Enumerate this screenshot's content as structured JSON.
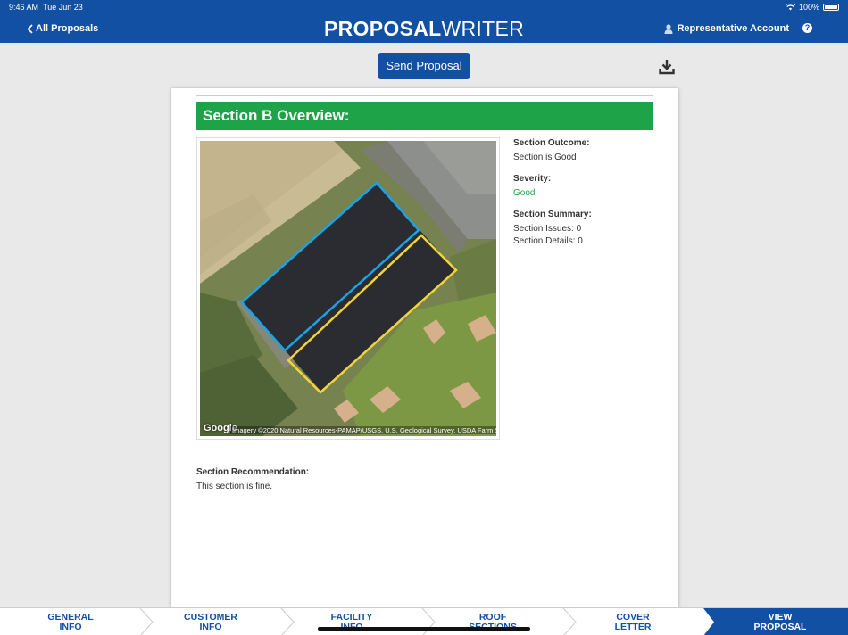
{
  "status": {
    "time": "9:46 AM",
    "date": "Tue Jun 23",
    "battery": "100%"
  },
  "header": {
    "back_label": "All Proposals",
    "brand_bold": "PROPOSAL",
    "brand_light": "WRITER",
    "account_label": "Representative Account",
    "help_glyph": "?"
  },
  "toolbar": {
    "send_label": "Send Proposal",
    "download_icon": "download-icon"
  },
  "section": {
    "title": "Section B Overview:",
    "outcome_label": "Section Outcome:",
    "outcome_value": "Section is Good",
    "severity_label": "Severity:",
    "severity_value": "Good",
    "summary_label": "Section Summary:",
    "issues": "Section Issues: 0",
    "details": "Section Details: 0",
    "recommendation_label": "Section Recommendation:",
    "recommendation_value": "This section is fine."
  },
  "map": {
    "logo": "Google",
    "attribution": "Imagery ©2020 Natural Resources-PAMAP/USGS, U.S. Geological Survey, USDA Farm Service Agency"
  },
  "colors": {
    "brand_blue": "#1150a3",
    "section_green": "#1fa349",
    "outline_blue": "#1aa3e8",
    "outline_yellow": "#f2d33a"
  },
  "nav": {
    "steps": [
      {
        "label": "GENERAL INFO"
      },
      {
        "label": "CUSTOMER INFO"
      },
      {
        "label": "FACILITY INFO"
      },
      {
        "label": "ROOF SECTIONS"
      },
      {
        "label": "COVER LETTER"
      },
      {
        "label": "VIEW PROPOSAL"
      }
    ],
    "active_index": 5
  }
}
